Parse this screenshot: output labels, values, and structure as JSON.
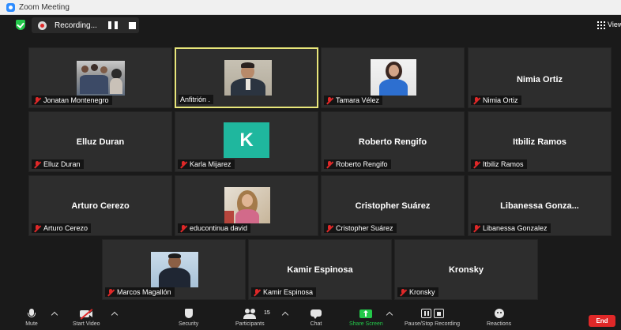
{
  "window": {
    "title": "Zoom Meeting"
  },
  "topbar": {
    "recording_label": "Recording...",
    "view_label": "View"
  },
  "tiles": [
    {
      "name": "Jonatan Montenegro",
      "display": "",
      "type": "photo-group"
    },
    {
      "name": "Anfitrión .",
      "display": "",
      "type": "photo-host"
    },
    {
      "name": "Tamara Vélez",
      "display": "",
      "type": "photo-woman"
    },
    {
      "name": "Nimia Ortiz",
      "display": "Nimia Ortiz",
      "type": "text"
    },
    {
      "name": "Elluz Duran",
      "display": "Elluz Duran",
      "type": "text"
    },
    {
      "name": "Karla Mijarez",
      "display": "",
      "type": "avatar",
      "initial": "K"
    },
    {
      "name": "Roberto Rengifo",
      "display": "Roberto Rengifo",
      "type": "text"
    },
    {
      "name": "Itbiliz Ramos",
      "display": "Itbiliz Ramos",
      "type": "text"
    },
    {
      "name": "Arturo Cerezo",
      "display": "Arturo Cerezo",
      "type": "text"
    },
    {
      "name": "educontinua david",
      "display": "",
      "type": "photo-woman2"
    },
    {
      "name": "Cristopher Suárez",
      "display": "Cristopher Suárez",
      "type": "text"
    },
    {
      "name": "Libanessa Gonzalez",
      "display": "Libanessa  Gonza...",
      "type": "text"
    },
    {
      "name": "Marcos Magallón",
      "display": "",
      "type": "photo-man"
    },
    {
      "name": "Kamir Espinosa",
      "display": "Kamir Espinosa",
      "type": "text"
    },
    {
      "name": "Kronsky",
      "display": "Kronsky",
      "type": "text"
    }
  ],
  "toolbar": {
    "mute": "Mute",
    "start_video": "Start Video",
    "security": "Security",
    "participants": "Participants",
    "participants_count": "15",
    "chat": "Chat",
    "share_screen": "Share Screen",
    "pause_stop_recording": "Pause/Stop Recording",
    "reactions": "Reactions",
    "end": "End"
  },
  "colors": {
    "accent_green": "#23c84a",
    "end_red": "#e02828",
    "active_border": "#e8e67a",
    "avatar_teal": "#1fb79e"
  }
}
